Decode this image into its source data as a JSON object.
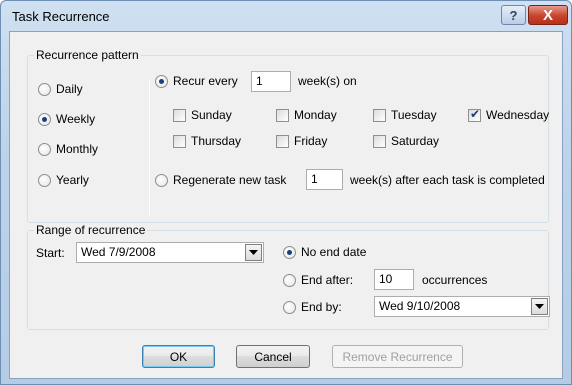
{
  "window": {
    "title": "Task Recurrence",
    "help_glyph": "?",
    "close_glyph": "X"
  },
  "pattern": {
    "group_label": "Recurrence pattern",
    "options": [
      "Daily",
      "Weekly",
      "Monthly",
      "Yearly"
    ],
    "selected_option": "Weekly",
    "recur_every_label": "Recur every",
    "recur_every_value": "1",
    "weeks_on_label": "week(s) on",
    "days": [
      {
        "label": "Sunday",
        "checked": false
      },
      {
        "label": "Monday",
        "checked": false
      },
      {
        "label": "Tuesday",
        "checked": false
      },
      {
        "label": "Wednesday",
        "checked": true
      },
      {
        "label": "Thursday",
        "checked": false
      },
      {
        "label": "Friday",
        "checked": false
      },
      {
        "label": "Saturday",
        "checked": false
      }
    ],
    "regenerate_label": "Regenerate new task",
    "regenerate_value": "1",
    "regenerate_suffix": "week(s) after each task is completed",
    "recur_mode": "recur-every"
  },
  "range": {
    "group_label": "Range of recurrence",
    "start_label": "Start:",
    "start_value": "Wed 7/9/2008",
    "no_end_label": "No end date",
    "end_after_label": "End after:",
    "end_after_value": "10",
    "occurrences_label": "occurrences",
    "end_by_label": "End by:",
    "end_by_value": "Wed 9/10/2008",
    "selected_end": "no-end-date"
  },
  "buttons": {
    "ok": "OK",
    "cancel": "Cancel",
    "remove": "Remove Recurrence"
  },
  "colors": {
    "accent": "#1b3f7a",
    "close_red": "#c8432b",
    "title_gradient": "#bcd3ea"
  }
}
